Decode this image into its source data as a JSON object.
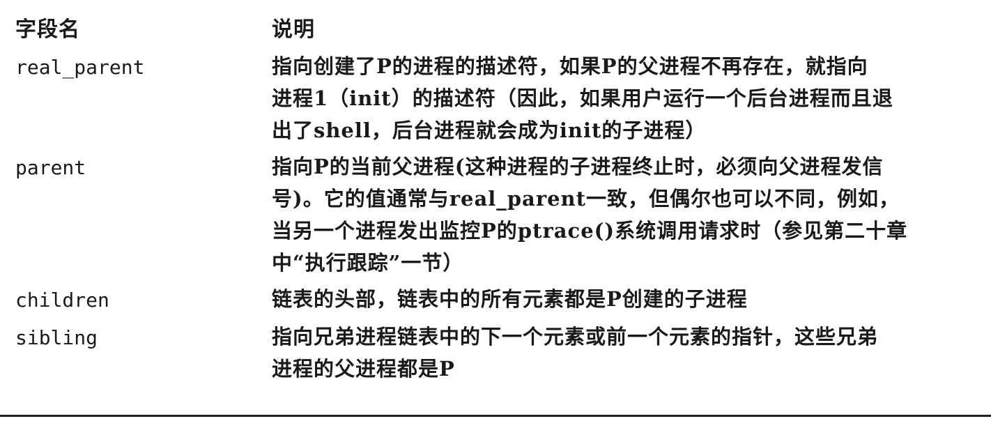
{
  "table": {
    "headers": {
      "field": "字段名",
      "description": "说明"
    },
    "rows": [
      {
        "field": "real_parent",
        "lines": [
          "指向创建了P的进程的描述符，如果P的父进程不再存在，就指向",
          "进程1（init）的描述符（因此，如果用户运行一个后台进程而且退",
          "出了shell，后台进程就会成为init的子进程）"
        ]
      },
      {
        "field": "parent",
        "lines": [
          "指向P的当前父进程(这种进程的子进程终止时，必须向父进程发信",
          "号)。它的值通常与real_parent一致，但偶尔也可以不同，例如，",
          "当另一个进程发出监控P的ptrace()系统调用请求时（参见第二十章",
          "中“执行跟踪”一节）"
        ]
      },
      {
        "field": "children",
        "lines": [
          "链表的头部，链表中的所有元素都是P创建的子进程"
        ]
      },
      {
        "field": "sibling",
        "lines": [
          "指向兄弟进程链表中的下一个元素或前一个元素的指针，这些兄弟",
          "进程的父进程都是P"
        ]
      }
    ]
  }
}
